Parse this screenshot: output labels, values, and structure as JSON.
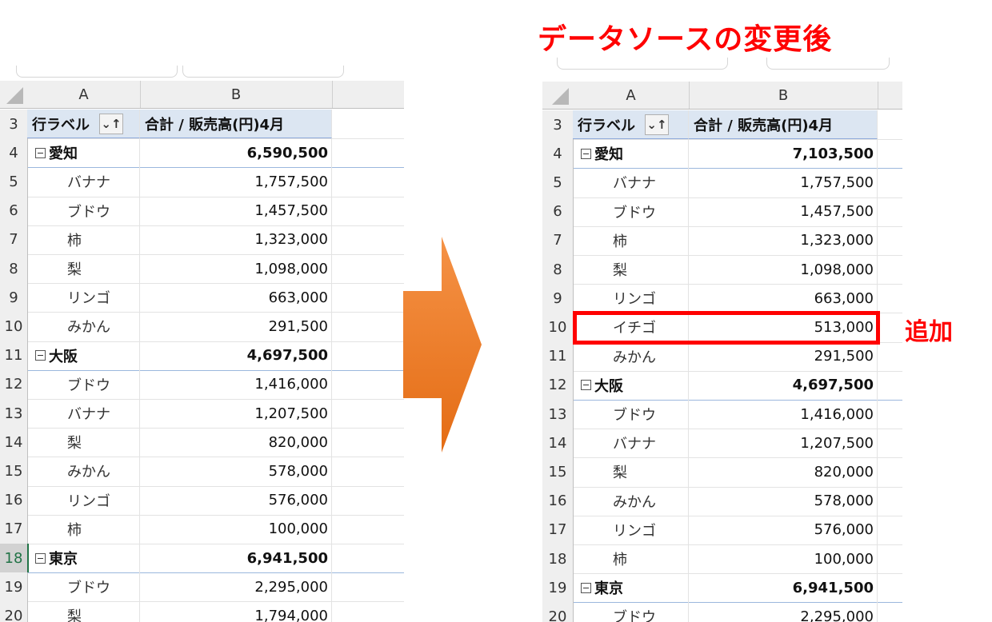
{
  "title": "データソースの変更後",
  "added_label": "追加",
  "col_a": "A",
  "col_b": "B",
  "header": {
    "row_label": "行ラベル",
    "sort_icon": "⌄↑",
    "value_label": "合計 / 販売高(円)4月"
  },
  "left_rows": [
    {
      "n": "3",
      "type": "header"
    },
    {
      "n": "4",
      "type": "group",
      "label": "愛知",
      "value": "6,590,500"
    },
    {
      "n": "5",
      "type": "item",
      "label": "バナナ",
      "value": "1,757,500"
    },
    {
      "n": "6",
      "type": "item",
      "label": "ブドウ",
      "value": "1,457,500"
    },
    {
      "n": "7",
      "type": "item",
      "label": "柿",
      "value": "1,323,000"
    },
    {
      "n": "8",
      "type": "item",
      "label": "梨",
      "value": "1,098,000"
    },
    {
      "n": "9",
      "type": "item",
      "label": "リンゴ",
      "value": "663,000"
    },
    {
      "n": "10",
      "type": "item",
      "label": "みかん",
      "value": "291,500"
    },
    {
      "n": "11",
      "type": "group",
      "label": "大阪",
      "value": "4,697,500"
    },
    {
      "n": "12",
      "type": "item",
      "label": "ブドウ",
      "value": "1,416,000"
    },
    {
      "n": "13",
      "type": "item",
      "label": "バナナ",
      "value": "1,207,500"
    },
    {
      "n": "14",
      "type": "item",
      "label": "梨",
      "value": "820,000"
    },
    {
      "n": "15",
      "type": "item",
      "label": "みかん",
      "value": "578,000"
    },
    {
      "n": "16",
      "type": "item",
      "label": "リンゴ",
      "value": "576,000"
    },
    {
      "n": "17",
      "type": "item",
      "label": "柿",
      "value": "100,000"
    },
    {
      "n": "18",
      "type": "group",
      "label": "東京",
      "value": "6,941,500",
      "selected": true
    },
    {
      "n": "19",
      "type": "item",
      "label": "ブドウ",
      "value": "2,295,000"
    },
    {
      "n": "20",
      "type": "item",
      "label": "梨",
      "value": "1,794,000"
    }
  ],
  "right_rows": [
    {
      "n": "3",
      "type": "header"
    },
    {
      "n": "4",
      "type": "group",
      "label": "愛知",
      "value": "7,103,500"
    },
    {
      "n": "5",
      "type": "item",
      "label": "バナナ",
      "value": "1,757,500"
    },
    {
      "n": "6",
      "type": "item",
      "label": "ブドウ",
      "value": "1,457,500"
    },
    {
      "n": "7",
      "type": "item",
      "label": "柿",
      "value": "1,323,000"
    },
    {
      "n": "8",
      "type": "item",
      "label": "梨",
      "value": "1,098,000"
    },
    {
      "n": "9",
      "type": "item",
      "label": "リンゴ",
      "value": "663,000"
    },
    {
      "n": "10",
      "type": "item",
      "label": "イチゴ",
      "value": "513,000"
    },
    {
      "n": "11",
      "type": "item",
      "label": "みかん",
      "value": "291,500"
    },
    {
      "n": "12",
      "type": "group",
      "label": "大阪",
      "value": "4,697,500"
    },
    {
      "n": "13",
      "type": "item",
      "label": "ブドウ",
      "value": "1,416,000"
    },
    {
      "n": "14",
      "type": "item",
      "label": "バナナ",
      "value": "1,207,500"
    },
    {
      "n": "15",
      "type": "item",
      "label": "梨",
      "value": "820,000"
    },
    {
      "n": "16",
      "type": "item",
      "label": "みかん",
      "value": "578,000"
    },
    {
      "n": "17",
      "type": "item",
      "label": "リンゴ",
      "value": "576,000"
    },
    {
      "n": "18",
      "type": "item",
      "label": "柿",
      "value": "100,000"
    },
    {
      "n": "19",
      "type": "group",
      "label": "東京",
      "value": "6,941,500"
    },
    {
      "n": "20",
      "type": "item",
      "label": "ブドウ",
      "value": "2,295,000"
    }
  ],
  "colors": {
    "accent": "#ff0000",
    "arrow_top": "#f58c3c",
    "arrow_bottom": "#e8741e",
    "header_fill": "#dce6f2"
  }
}
